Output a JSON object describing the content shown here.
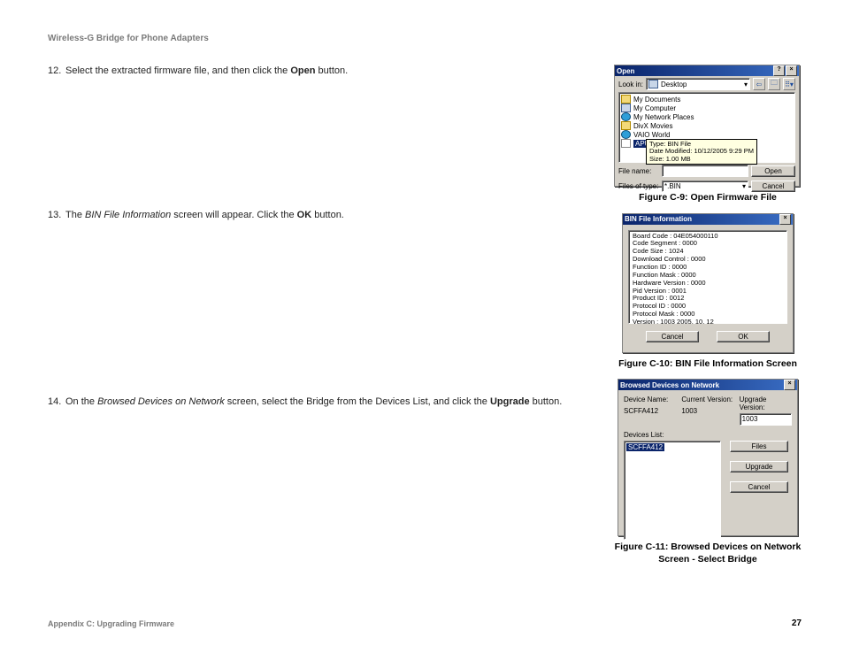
{
  "header": "Wireless-G Bridge for Phone Adapters",
  "steps": {
    "s12": {
      "num": "12.",
      "t1": "Select the extracted firmware file, and then click the ",
      "b1": "Open",
      "t2": " button."
    },
    "s13": {
      "num": "13.",
      "t1": "The ",
      "i1": "BIN File Information",
      "t2": " screen will appear. Click the ",
      "b1": "OK",
      "t3": " button."
    },
    "s14": {
      "num": "14.",
      "t1": "On the ",
      "i1": "Browsed Devices on Network",
      "t2": " screen, select the Bridge from the Devices List, and click the ",
      "b1": "Upgrade",
      "t3": " button."
    }
  },
  "captions": {
    "c9": "Figure C-9: Open Firmware File",
    "c10": "Figure C-10: BIN File Information Screen",
    "c11": "Figure C-11: Browsed Devices on Network Screen - Select Bridge"
  },
  "openDlg": {
    "title": "Open",
    "lookIn": "Look in:",
    "lookValue": "Desktop",
    "items": [
      {
        "icon": "folder",
        "label": "My Documents"
      },
      {
        "icon": "pc",
        "label": "My Computer"
      },
      {
        "icon": "globe",
        "label": "My Network Places"
      },
      {
        "icon": "folder",
        "label": "DivX Movies"
      },
      {
        "icon": "globe",
        "label": "VAIO World"
      },
      {
        "icon": "file",
        "label": "APUWGR",
        "selected": true,
        "tooltip": "Type: BIN File\nDate Modified: 10/12/2005 9:29 PM\nSize: 1.00 MB"
      }
    ],
    "fileNameLbl": "File name:",
    "fileTypeLbl": "Files of type:",
    "fileType": "*.BIN",
    "openBtn": "Open",
    "cancelBtn": "Cancel"
  },
  "binDlg": {
    "title": "BIN File Information",
    "lines": [
      "Board Code : 04E054000110",
      "Code Segment : 0000",
      "Code Size : 1024",
      "Download Control : 0000",
      "Function ID : 0000",
      "Function Mask : 0000",
      "Hardware Version : 0000",
      "Pid Version : 0001",
      "Product ID : 0012",
      "Protocol ID : 0000",
      "Protocol Mask : 0000",
      "Version : 1003  2005. 10. 12"
    ],
    "cancelBtn": "Cancel",
    "okBtn": "OK"
  },
  "brwDlg": {
    "title": "Browsed Devices on Network",
    "hdr": {
      "name": "Device Name:",
      "cur": "Current Version:",
      "upg": "Upgrade Version:"
    },
    "row": {
      "name": "SCFFA412",
      "cur": "1003",
      "upg": "1003"
    },
    "listLbl": "Devices List:",
    "listItem": "SCFFA412",
    "filesBtn": "Files",
    "upgradeBtn": "Upgrade",
    "cancelBtn": "Cancel"
  },
  "footer": {
    "appendix": "Appendix C: Upgrading Firmware",
    "page": "27"
  }
}
